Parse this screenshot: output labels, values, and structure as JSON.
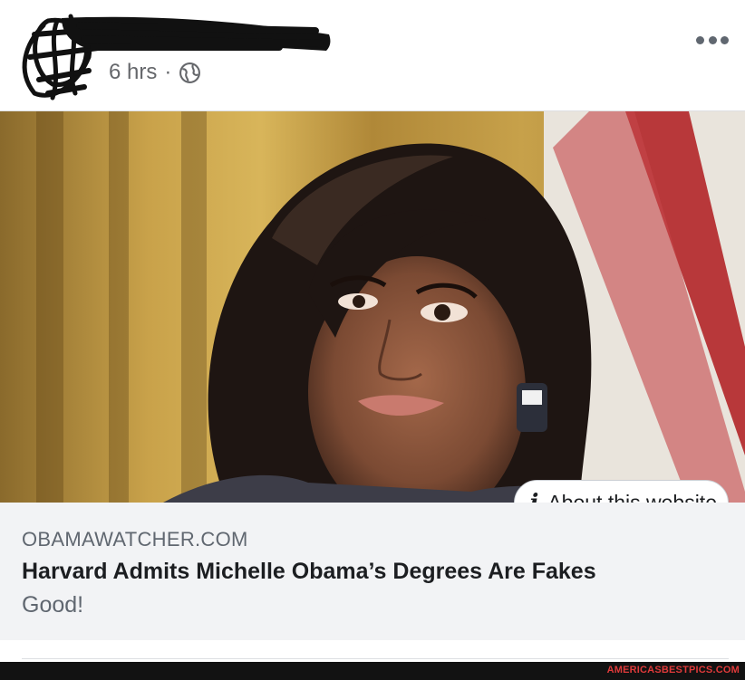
{
  "post": {
    "author_name": "",
    "timestamp": "6 hrs",
    "separator": "·",
    "privacy_icon": "globe-icon",
    "more_icon": "more-options-icon"
  },
  "link_preview": {
    "about_label": "About this website",
    "about_icon": "info-icon",
    "domain": "OBAMAWATCHER.COM",
    "headline": "Harvard Admits Michelle Obama’s Degrees Are Fakes",
    "subtitle": "Good!"
  },
  "watermark": "AMERICASBESTPICS.COM",
  "colors": {
    "secondary_text": "#65676b",
    "card_background": "#f2f3f5",
    "watermark": "#e03a3a"
  }
}
